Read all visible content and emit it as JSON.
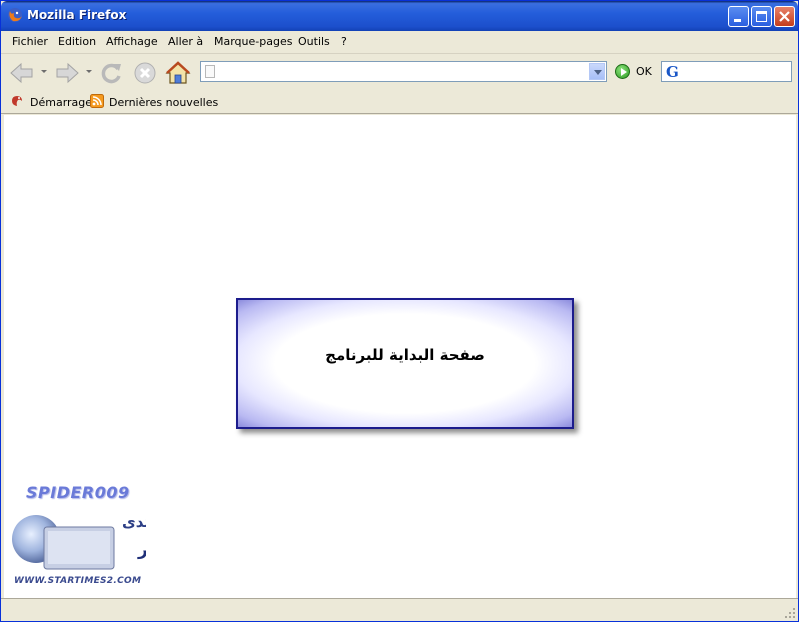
{
  "window": {
    "title": "Mozilla Firefox"
  },
  "menu": {
    "items": [
      {
        "label": "Fichier"
      },
      {
        "label": "Edition"
      },
      {
        "label": "Affichage"
      },
      {
        "label": "Aller à"
      },
      {
        "label": "Marque-pages"
      },
      {
        "label": "Outils"
      },
      {
        "label": "?"
      }
    ]
  },
  "toolbar": {
    "url_value": "",
    "go_label": "OK",
    "search_value": ""
  },
  "bookmarks": {
    "items": [
      {
        "label": "Démarrage",
        "icon": "firefox-bookmark-icon"
      },
      {
        "label": "Dernières nouvelles",
        "icon": "rss-feed-icon"
      }
    ]
  },
  "content": {
    "start_box_text": "صفحة البداية للبرنامج",
    "watermark_title": "SPIDER009",
    "watermark_logo_text": "منتدى برامج الكمبيوتر",
    "watermark_url": "WWW.STARTIMES2.COM"
  },
  "status": {
    "text": ""
  },
  "colors": {
    "titlebar": "#245edb",
    "chrome": "#ece9d8",
    "box_border": "#1c1c8c",
    "watermark": "#6a7ad8"
  }
}
